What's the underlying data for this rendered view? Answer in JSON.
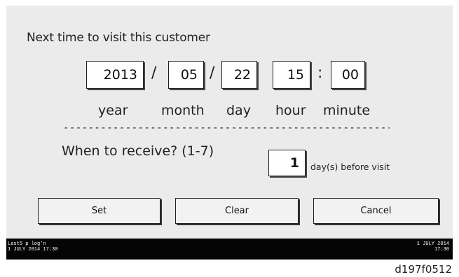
{
  "dialog": {
    "title": "Next time to visit this customer"
  },
  "date_fields": {
    "year": "2013",
    "month": "05",
    "day": "22",
    "hour": "15",
    "minute": "00",
    "date_separator": "/",
    "time_separator": ":"
  },
  "units": {
    "year": "year",
    "month": "month",
    "day": "day",
    "hour": "hour",
    "minute": "minute"
  },
  "divider_text": "------------------------------------------------------------",
  "receive": {
    "label": "When to receive? (1-7)",
    "value": "1",
    "suffix": "day(s) before visit"
  },
  "buttons": {
    "set": "Set",
    "clear": "Clear",
    "cancel": "Cancel"
  },
  "status_bar": {
    "left_line1": "Last5 p log'n",
    "left_line2": "1 JULY 2014 17:30",
    "right_line1": "1 JULY 2014",
    "right_line2": "17:30"
  },
  "figure_caption": "d197f0512"
}
